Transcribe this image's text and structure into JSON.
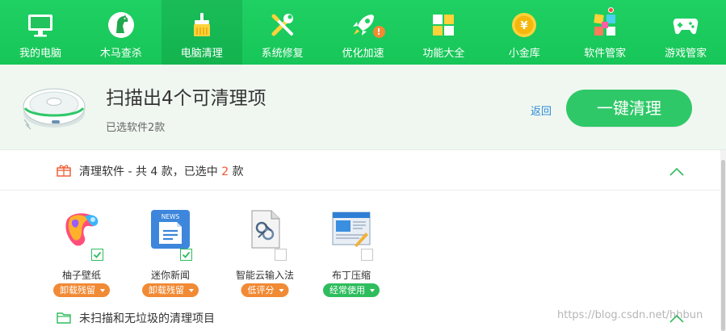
{
  "nav": {
    "items": [
      {
        "label": "我的电脑",
        "icon": "monitor-icon"
      },
      {
        "label": "木马查杀",
        "icon": "trojan-horse-icon"
      },
      {
        "label": "电脑清理",
        "icon": "broom-icon",
        "active": true
      },
      {
        "label": "系统修复",
        "icon": "wrench-screwdriver-icon"
      },
      {
        "label": "优化加速",
        "icon": "rocket-icon",
        "badge": "!"
      },
      {
        "label": "功能大全",
        "icon": "grid-icon"
      },
      {
        "label": "小金库",
        "icon": "gold-coin-icon",
        "coin_symbol": "¥"
      },
      {
        "label": "软件管家",
        "icon": "software-manager-icon",
        "dot": true
      },
      {
        "label": "游戏管家",
        "icon": "gamepad-icon"
      }
    ]
  },
  "summary": {
    "title": "扫描出4个可清理项",
    "subtitle": "已选软件2款",
    "back_label": "返回",
    "clean_button_label": "一键清理"
  },
  "section_software": {
    "prefix": "清理软件 - 共 4 款，已选中 ",
    "selected_count": "2",
    "suffix": " 款"
  },
  "apps": [
    {
      "name": "柚子壁纸",
      "icon": "youzi-wallpaper-icon",
      "checked": true,
      "tag": "卸载残留",
      "tag_color": "#f18a35"
    },
    {
      "name": "迷你新闻",
      "icon": "mini-news-icon",
      "checked": true,
      "tag": "卸载残留",
      "tag_color": "#f18a35",
      "icon_text": "NEWS"
    },
    {
      "name": "智能云输入法",
      "icon": "cloud-input-method-icon",
      "checked": false,
      "tag": "低评分",
      "tag_color": "#f18a35"
    },
    {
      "name": "布丁压缩",
      "icon": "pudding-compress-icon",
      "checked": false,
      "tag": "经常使用",
      "tag_color": "#2ebd5d"
    }
  ],
  "section_unscanned": {
    "title": "未扫描和无垃圾的清理项目"
  },
  "watermark": "https://blog.csdn.net/hhbun",
  "colors": {
    "brand_green": "#1fd063",
    "button_green": "#2fc868",
    "link_blue": "#2b8cd6",
    "highlight_orange": "#f0562c",
    "tag_orange": "#f18a35",
    "tag_green": "#2ebd5d"
  }
}
